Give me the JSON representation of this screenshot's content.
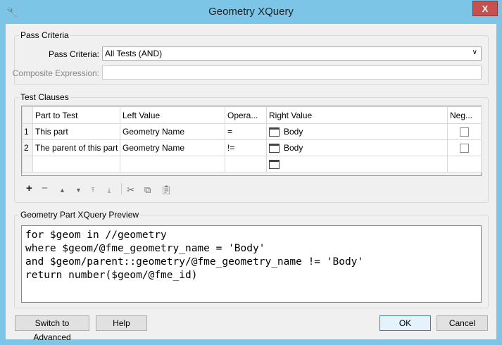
{
  "window": {
    "title": "Geometry XQuery",
    "close_label": "X"
  },
  "pass_criteria": {
    "group_label": "Pass Criteria",
    "criteria_label": "Pass Criteria:",
    "criteria_value": "All Tests (AND)",
    "composite_label": "Composite Expression:",
    "composite_value": ""
  },
  "test_clauses": {
    "group_label": "Test Clauses",
    "columns": [
      "Part to Test",
      "Left Value",
      "Opera...",
      "Right Value",
      "Neg..."
    ],
    "rows": [
      {
        "num": "1",
        "part": "This part",
        "left": "Geometry Name",
        "op": "=",
        "right": "Body",
        "negate": false
      },
      {
        "num": "2",
        "part": "The parent of this part",
        "left": "Geometry Name",
        "op": "!=",
        "right": "Body",
        "negate": false
      }
    ]
  },
  "preview": {
    "group_label": "Geometry Part XQuery Preview",
    "code": "for $geom in //geometry\nwhere $geom/@fme_geometry_name = 'Body'\nand $geom/parent::geometry/@fme_geometry_name != 'Body'\nreturn number($geom/@fme_id)"
  },
  "buttons": {
    "advanced": "Switch to Advanced",
    "help": "Help",
    "ok": "OK",
    "cancel": "Cancel"
  }
}
